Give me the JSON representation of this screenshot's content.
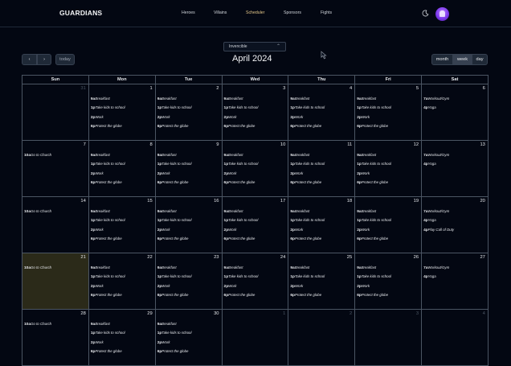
{
  "nav": {
    "brand": "GUARDIANS",
    "links": [
      "Heroes",
      "Villains",
      "Scheduler",
      "Sponsors",
      "Fights"
    ]
  },
  "toolbar": {
    "select_value": "Invencible",
    "prev": "‹",
    "next": "›",
    "today": "today",
    "title": "April 2024",
    "views": [
      "month",
      "week",
      "day"
    ]
  },
  "colors": {
    "accent": "#e7c98a",
    "today_bg": "#2b2a19",
    "background": "#030712"
  },
  "calendar": {
    "days": [
      "Sun",
      "Mon",
      "Tue",
      "Wed",
      "Thu",
      "Fri",
      "Sat"
    ],
    "weeks": [
      [
        {
          "d": "31",
          "other": true,
          "ev": []
        },
        {
          "d": "1",
          "ev": [
            [
              "9a",
              "Breakfast"
            ],
            [
              "1p",
              "Take kids to school"
            ],
            [
              "2p",
              "Work"
            ],
            [
              "6p",
              "Protect the globe"
            ]
          ]
        },
        {
          "d": "2",
          "ev": [
            [
              "9a",
              "Breakfast"
            ],
            [
              "1p",
              "Take kids to school"
            ],
            [
              "2p",
              "Work"
            ],
            [
              "6p",
              "Protect the globe"
            ]
          ]
        },
        {
          "d": "3",
          "ev": [
            [
              "9a",
              "Breakfast"
            ],
            [
              "1p",
              "Take kids to school"
            ],
            [
              "2p",
              "Work"
            ],
            [
              "6p",
              "Protect the globe"
            ]
          ]
        },
        {
          "d": "4",
          "ev": [
            [
              "9a",
              "Breakfast"
            ],
            [
              "1p",
              "Take kids to school"
            ],
            [
              "2p",
              "Work"
            ],
            [
              "6p",
              "Protect the globe"
            ]
          ]
        },
        {
          "d": "5",
          "ev": [
            [
              "9a",
              "Breakfast"
            ],
            [
              "1p",
              "Take kids to school"
            ],
            [
              "2p",
              "Work"
            ],
            [
              "6p",
              "Protect the globe"
            ]
          ]
        },
        {
          "d": "6",
          "ev": [
            [
              "7a",
              "Workout/Gym"
            ],
            [
              "4p",
              "Yoga"
            ]
          ]
        }
      ],
      [
        {
          "d": "7",
          "ev": [
            [
              "10a",
              "Go to Church"
            ]
          ]
        },
        {
          "d": "8",
          "ev": [
            [
              "9a",
              "Breakfast"
            ],
            [
              "1p",
              "Take kids to school"
            ],
            [
              "2p",
              "Work"
            ],
            [
              "6p",
              "Protect the globe"
            ]
          ]
        },
        {
          "d": "9",
          "ev": [
            [
              "9a",
              "Breakfast"
            ],
            [
              "1p",
              "Take kids to school"
            ],
            [
              "2p",
              "Work"
            ],
            [
              "6p",
              "Protect the globe"
            ]
          ]
        },
        {
          "d": "10",
          "ev": [
            [
              "9a",
              "Breakfast"
            ],
            [
              "1p",
              "Take kids to school"
            ],
            [
              "2p",
              "Work"
            ],
            [
              "6p",
              "Protect the globe"
            ]
          ]
        },
        {
          "d": "11",
          "ev": [
            [
              "9a",
              "Breakfast"
            ],
            [
              "1p",
              "Take kids to school"
            ],
            [
              "2p",
              "Work"
            ],
            [
              "6p",
              "Protect the globe"
            ]
          ]
        },
        {
          "d": "12",
          "ev": [
            [
              "9a",
              "Breakfast"
            ],
            [
              "1p",
              "Take kids to school"
            ],
            [
              "2p",
              "Work"
            ],
            [
              "6p",
              "Protect the globe"
            ]
          ]
        },
        {
          "d": "13",
          "ev": [
            [
              "7a",
              "Workout/Gym"
            ],
            [
              "4p",
              "Yoga"
            ]
          ]
        }
      ],
      [
        {
          "d": "14",
          "ev": [
            [
              "10a",
              "Go to Church"
            ]
          ]
        },
        {
          "d": "15",
          "ev": [
            [
              "9a",
              "Breakfast"
            ],
            [
              "1p",
              "Take kids to school"
            ],
            [
              "2p",
              "Work"
            ],
            [
              "6p",
              "Protect the globe"
            ]
          ]
        },
        {
          "d": "16",
          "ev": [
            [
              "9a",
              "Breakfast"
            ],
            [
              "1p",
              "Take kids to school"
            ],
            [
              "2p",
              "Work"
            ],
            [
              "6p",
              "Protect the globe"
            ]
          ]
        },
        {
          "d": "17",
          "ev": [
            [
              "9a",
              "Breakfast"
            ],
            [
              "1p",
              "Take kids to school"
            ],
            [
              "2p",
              "Work"
            ],
            [
              "6p",
              "Protect the globe"
            ]
          ]
        },
        {
          "d": "18",
          "ev": [
            [
              "9a",
              "Breakfast"
            ],
            [
              "1p",
              "Take kids to school"
            ],
            [
              "2p",
              "Work"
            ],
            [
              "6p",
              "Protect the globe"
            ]
          ]
        },
        {
          "d": "19",
          "ev": [
            [
              "9a",
              "Breakfast"
            ],
            [
              "1p",
              "Take kids to school"
            ],
            [
              "2p",
              "Work"
            ],
            [
              "6p",
              "Protect the globe"
            ]
          ]
        },
        {
          "d": "20",
          "ev": [
            [
              "7a",
              "Workout/Gym"
            ],
            [
              "4p",
              "Yoga"
            ],
            [
              "4p",
              "Play Call of Duty"
            ]
          ]
        }
      ],
      [
        {
          "d": "21",
          "today": true,
          "ev": [
            [
              "10a",
              "Go to Church"
            ]
          ]
        },
        {
          "d": "22",
          "ev": [
            [
              "9a",
              "Breakfast"
            ],
            [
              "1p",
              "Take kids to school"
            ],
            [
              "2p",
              "Work"
            ],
            [
              "6p",
              "Protect the globe"
            ]
          ]
        },
        {
          "d": "23",
          "ev": [
            [
              "9a",
              "Breakfast"
            ],
            [
              "1p",
              "Take kids to school"
            ],
            [
              "2p",
              "Work"
            ],
            [
              "6p",
              "Protect the globe"
            ]
          ]
        },
        {
          "d": "24",
          "ev": [
            [
              "9a",
              "Breakfast"
            ],
            [
              "1p",
              "Take kids to school"
            ],
            [
              "2p",
              "Work"
            ],
            [
              "6p",
              "Protect the globe"
            ]
          ]
        },
        {
          "d": "25",
          "ev": [
            [
              "9a",
              "Breakfast"
            ],
            [
              "1p",
              "Take kids to school"
            ],
            [
              "2p",
              "Work"
            ],
            [
              "6p",
              "Protect the globe"
            ]
          ]
        },
        {
          "d": "26",
          "ev": [
            [
              "9a",
              "Breakfast"
            ],
            [
              "1p",
              "Take kids to school"
            ],
            [
              "2p",
              "Work"
            ],
            [
              "6p",
              "Protect the globe"
            ]
          ]
        },
        {
          "d": "27",
          "ev": [
            [
              "7a",
              "Workout/Gym"
            ],
            [
              "4p",
              "Yoga"
            ]
          ]
        }
      ],
      [
        {
          "d": "28",
          "ev": [
            [
              "10a",
              "Go to Church"
            ]
          ]
        },
        {
          "d": "29",
          "ev": [
            [
              "9a",
              "Breakfast"
            ],
            [
              "1p",
              "Take kids to school"
            ],
            [
              "2p",
              "Work"
            ],
            [
              "6p",
              "Protect the globe"
            ]
          ]
        },
        {
          "d": "30",
          "ev": [
            [
              "9a",
              "Breakfast"
            ],
            [
              "1p",
              "Take kids to school"
            ],
            [
              "2p",
              "Work"
            ],
            [
              "6p",
              "Protect the globe"
            ]
          ]
        },
        {
          "d": "1",
          "other": true,
          "ev": []
        },
        {
          "d": "2",
          "other": true,
          "ev": []
        },
        {
          "d": "3",
          "other": true,
          "ev": []
        },
        {
          "d": "4",
          "other": true,
          "ev": []
        }
      ]
    ]
  }
}
